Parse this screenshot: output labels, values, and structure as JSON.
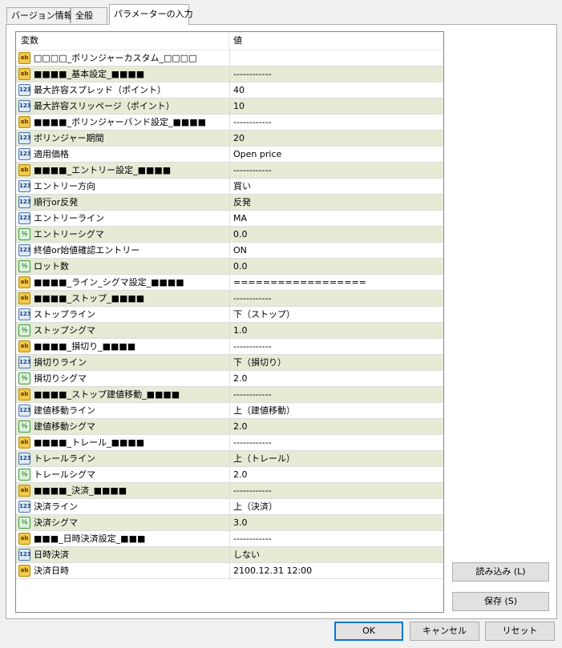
{
  "tabs": [
    {
      "label": "バージョン情報"
    },
    {
      "label": "全般"
    },
    {
      "label": "パラメーターの入力"
    }
  ],
  "grid": {
    "col_variable": "変数",
    "col_value": "値",
    "rows": [
      {
        "icon": "ab",
        "name": "□□□□_ボリンジャーカスタム_□□□□",
        "value": ""
      },
      {
        "icon": "ab",
        "name": "■■■■_基本設定_■■■■",
        "value": "------------"
      },
      {
        "icon": "123",
        "name": "最大許容スプレッド（ポイント）",
        "value": "40"
      },
      {
        "icon": "123",
        "name": "最大許容スリッページ（ポイント）",
        "value": "10"
      },
      {
        "icon": "ab",
        "name": "■■■■_ボリンジャーバンド設定_■■■■",
        "value": "------------"
      },
      {
        "icon": "123",
        "name": "ボリンジャー期間",
        "value": "20"
      },
      {
        "icon": "123",
        "name": "適用価格",
        "value": "Open price"
      },
      {
        "icon": "ab",
        "name": "■■■■_エントリー設定_■■■■",
        "value": "------------"
      },
      {
        "icon": "123",
        "name": "エントリー方向",
        "value": "買い"
      },
      {
        "icon": "123",
        "name": "順行or反発",
        "value": "反発"
      },
      {
        "icon": "123",
        "name": "エントリーライン",
        "value": "MA"
      },
      {
        "icon": "v2",
        "name": "エントリーシグマ",
        "value": "0.0"
      },
      {
        "icon": "123",
        "name": "終値or始値確認エントリー",
        "value": "ON"
      },
      {
        "icon": "v2",
        "name": "ロット数",
        "value": "0.0"
      },
      {
        "icon": "ab",
        "name": "■■■■_ライン_シグマ設定_■■■■",
        "value": "=================="
      },
      {
        "icon": "ab",
        "name": "■■■■_ストップ_■■■■",
        "value": "------------"
      },
      {
        "icon": "123",
        "name": "ストップライン",
        "value": "下（ストップ）"
      },
      {
        "icon": "v2",
        "name": "ストップシグマ",
        "value": "1.0"
      },
      {
        "icon": "ab",
        "name": "■■■■_損切り_■■■■",
        "value": "------------"
      },
      {
        "icon": "123",
        "name": "損切りライン",
        "value": "下（損切り）"
      },
      {
        "icon": "v2",
        "name": "損切りシグマ",
        "value": "2.0"
      },
      {
        "icon": "ab",
        "name": "■■■■_ストップ建値移動_■■■■",
        "value": "------------"
      },
      {
        "icon": "123",
        "name": "建値移動ライン",
        "value": "上（建値移動）"
      },
      {
        "icon": "v2",
        "name": "建値移動シグマ",
        "value": "2.0"
      },
      {
        "icon": "ab",
        "name": "■■■■_トレール_■■■■",
        "value": "------------"
      },
      {
        "icon": "123",
        "name": "トレールライン",
        "value": "上（トレール）"
      },
      {
        "icon": "v2",
        "name": "トレールシグマ",
        "value": "2.0"
      },
      {
        "icon": "ab",
        "name": "■■■■_決済_■■■■",
        "value": "------------"
      },
      {
        "icon": "123",
        "name": "決済ライン",
        "value": "上（決済）"
      },
      {
        "icon": "v2",
        "name": "決済シグマ",
        "value": "3.0"
      },
      {
        "icon": "ab",
        "name": "■■■_日時決済設定_■■■",
        "value": "------------"
      },
      {
        "icon": "123",
        "name": "日時決済",
        "value": "しない"
      },
      {
        "icon": "ab",
        "name": "決済日時",
        "value": "2100.12.31 12:00"
      }
    ]
  },
  "buttons": {
    "load": "読み込み (L)",
    "save": "保存 (S)",
    "ok": "OK",
    "cancel": "キャンセル",
    "reset": "リセット"
  }
}
